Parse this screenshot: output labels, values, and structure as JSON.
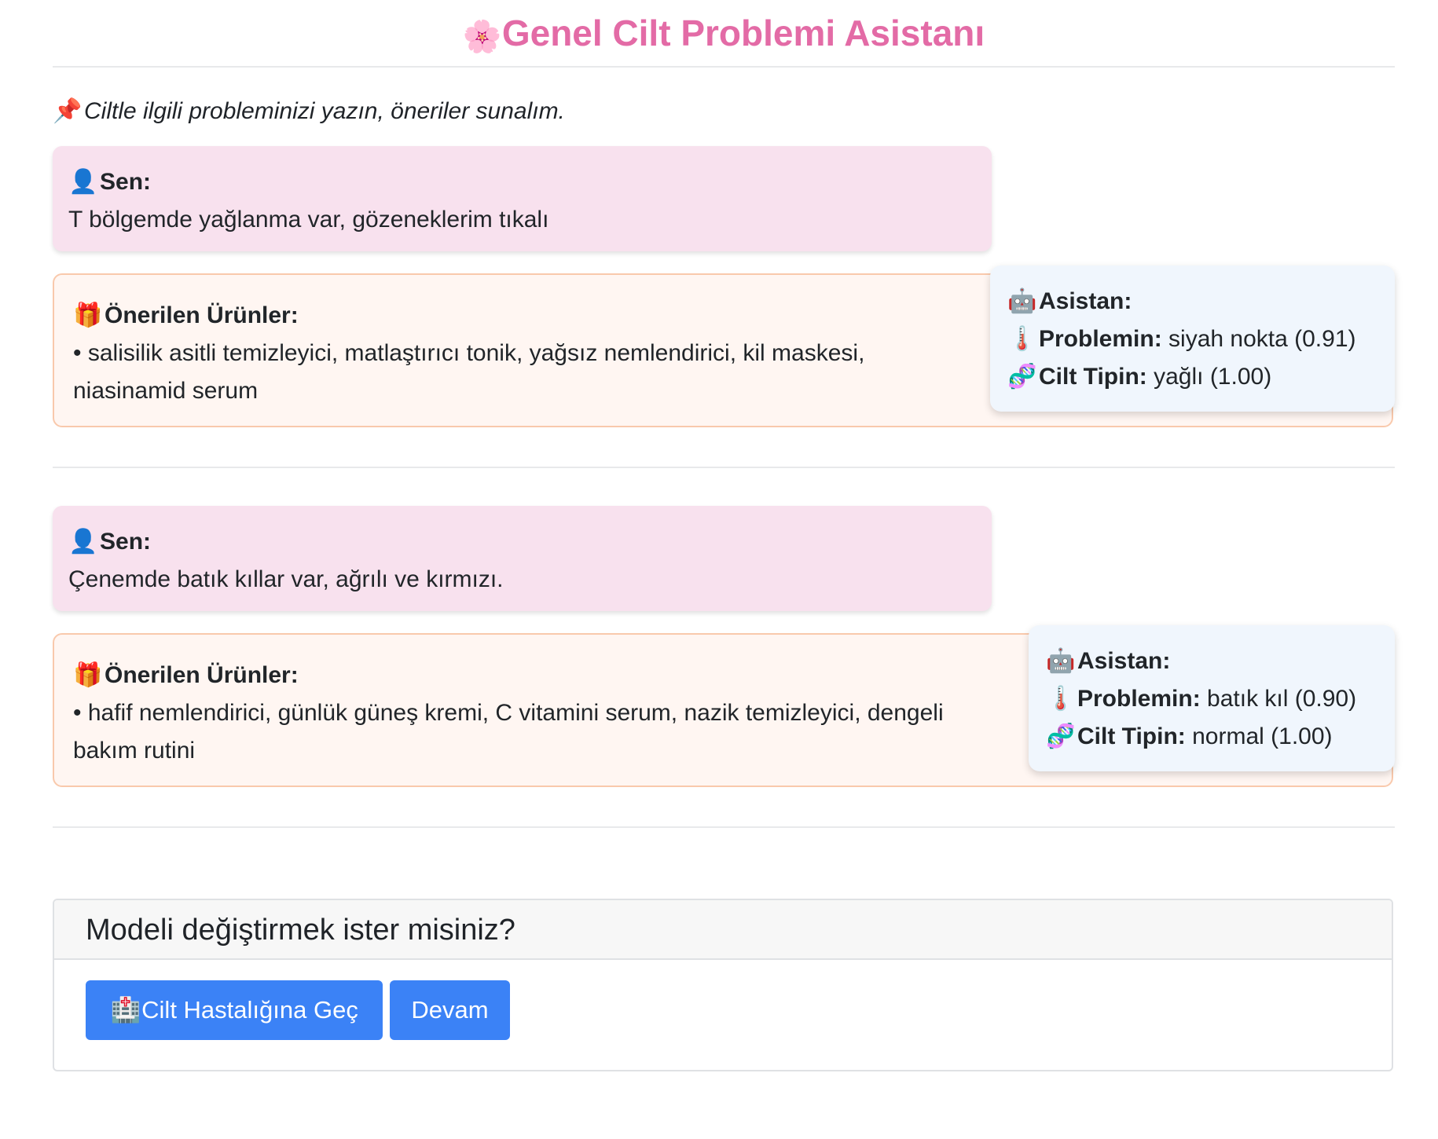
{
  "header": {
    "title": "Genel Cilt Problemi Asistanı",
    "icon": "cherry-blossom-icon"
  },
  "intro": {
    "text": "Ciltle ilgili probleminizi yazın, öneriler sunalım.",
    "icon": "pushpin-icon"
  },
  "conversation": [
    {
      "user_label": "Sen:",
      "user_message": "T bölgemde yağlanma var, gözeneklerim tıkalı",
      "products_label": "Önerilen Ürünler:",
      "products": "• salisilik asitli temizleyici, matlaştırıcı tonik, yağsız nemlendirici, kil maskesi, niasinamid serum",
      "assistant_label": "Asistan:",
      "problem_label": "Problemin:",
      "problem_value": "siyah nokta (0.91)",
      "skin_label": "Cilt Tipin:",
      "skin_value": "yağlı (1.00)"
    },
    {
      "user_label": "Sen:",
      "user_message": "Çenemde batık kıllar var, ağrılı ve kırmızı.",
      "products_label": "Önerilen Ürünler:",
      "products": "• hafif nemlendirici, günlük güneş kremi, C vitamini serum, nazik temizleyici, dengeli bakım rutini",
      "assistant_label": "Asistan:",
      "problem_label": "Problemin:",
      "problem_value": "batık kıl (0.90)",
      "skin_label": "Cilt Tipin:",
      "skin_value": "normal (1.00)"
    }
  ],
  "model_panel": {
    "title": "Modeli değiştirmek ister misiniz?",
    "switch_button": "Cilt Hastalığına Geç",
    "continue_button": "Devam"
  },
  "colors": {
    "title": "#e36ba6",
    "user_bubble": "#f8e1ee",
    "product_bubble": "#fff6f2",
    "assistant_bubble": "#f0f6fd",
    "button": "#3b82f6"
  }
}
